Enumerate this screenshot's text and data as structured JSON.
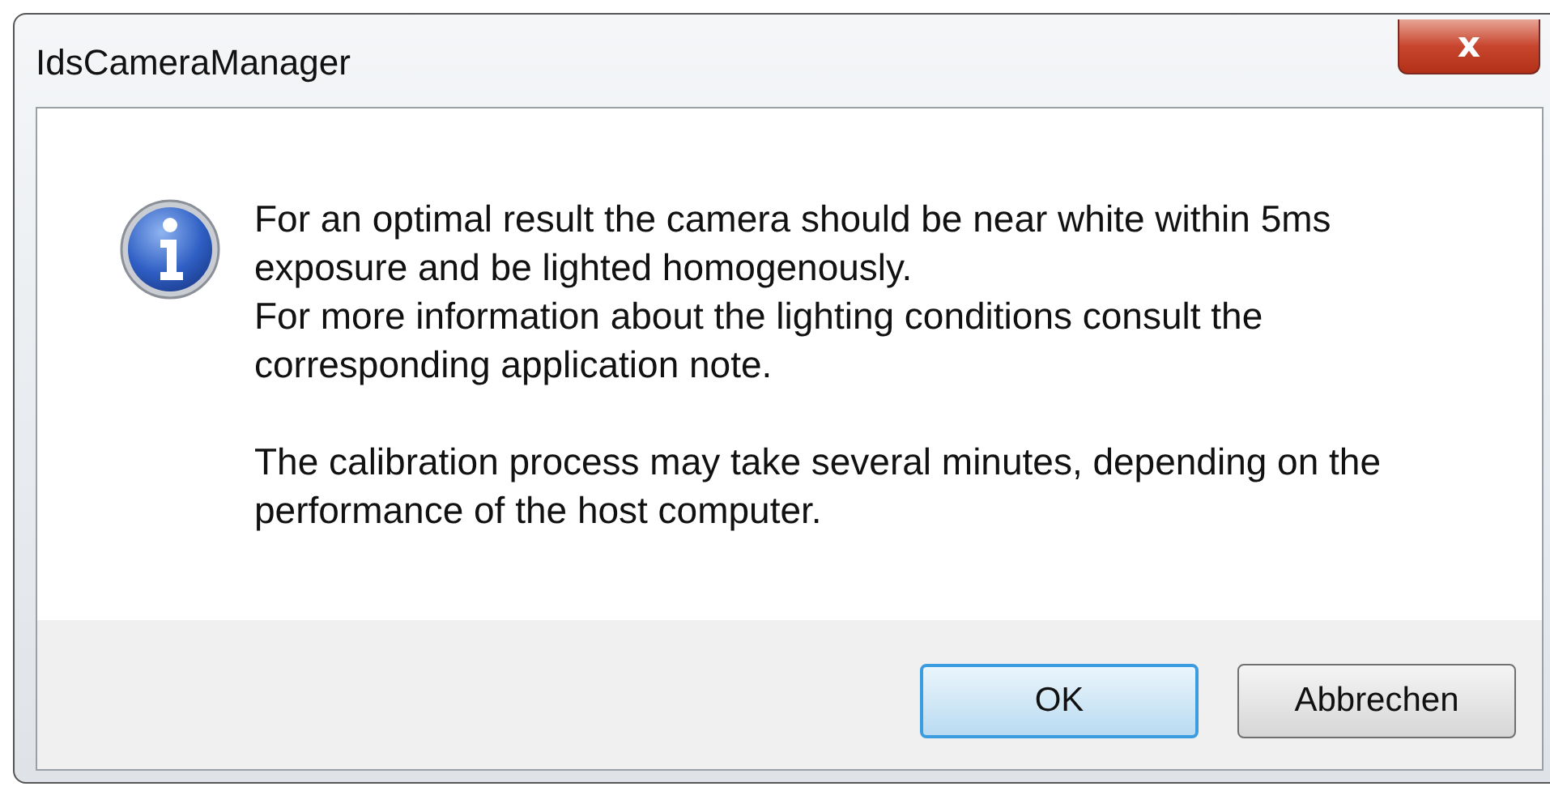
{
  "window": {
    "title": "IdsCameraManager",
    "close_label": "x"
  },
  "message": {
    "blocks": [
      [
        "For an optimal result the camera should be near white within 5ms exposure and be lighted homogenously.",
        "For more information about the lighting conditions consult the corresponding application note."
      ],
      [
        "The calibration process may take several minutes, depending on the performance of the host computer."
      ]
    ]
  },
  "buttons": [
    {
      "label": "OK",
      "default": true
    },
    {
      "label": "Abbrechen",
      "default": false
    }
  ]
}
